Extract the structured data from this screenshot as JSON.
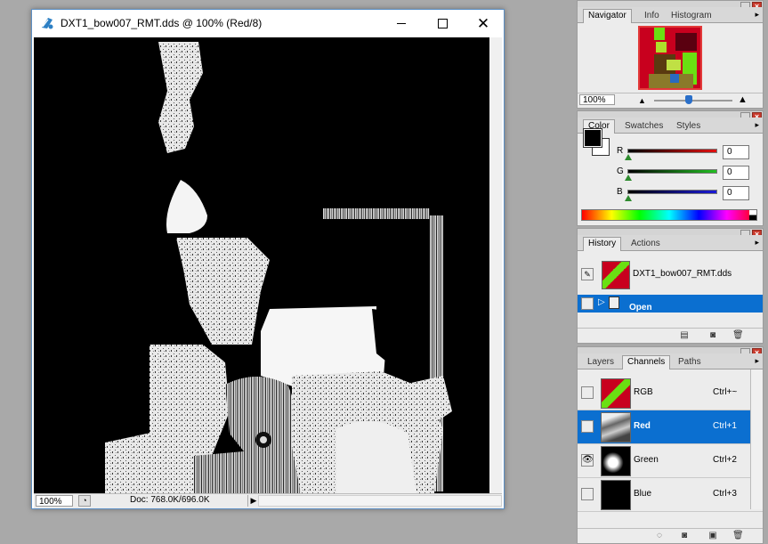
{
  "document": {
    "title": "DXT1_bow007_RMT.dds @ 100% (Red/8)",
    "zoom": "100%",
    "doc_size": "Doc: 768.0K/696.0K"
  },
  "navigator": {
    "tabs": [
      "Navigator",
      "Info",
      "Histogram"
    ],
    "zoom": "100%"
  },
  "color": {
    "tabs": [
      "Color",
      "Swatches",
      "Styles"
    ],
    "channels": [
      {
        "label": "R",
        "value": "0",
        "color": "#e21010"
      },
      {
        "label": "G",
        "value": "0",
        "color": "#22c022"
      },
      {
        "label": "B",
        "value": "0",
        "color": "#1a1ad8"
      }
    ],
    "foreground": "#000000",
    "background": "#ffffff"
  },
  "history": {
    "tabs": [
      "History",
      "Actions"
    ],
    "snapshot": "DXT1_bow007_RMT.dds",
    "states": [
      "Open"
    ]
  },
  "channels": {
    "tabs": [
      "Layers",
      "Channels",
      "Paths"
    ],
    "rows": [
      {
        "name": "RGB",
        "shortcut": "Ctrl+~",
        "visible": false,
        "selected": false
      },
      {
        "name": "Red",
        "shortcut": "Ctrl+1",
        "visible": false,
        "selected": true
      },
      {
        "name": "Green",
        "shortcut": "Ctrl+2",
        "visible": true,
        "selected": false
      },
      {
        "name": "Blue",
        "shortcut": "Ctrl+3",
        "visible": false,
        "selected": false
      }
    ]
  },
  "colors": {
    "selection_blue": "#0b6fd0",
    "close_red": "#c83a2d"
  }
}
